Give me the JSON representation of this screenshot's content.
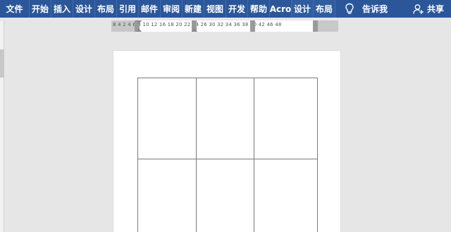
{
  "ribbon": {
    "tabs": [
      {
        "label": "文件"
      },
      {
        "label": "开始"
      },
      {
        "label": "插入"
      },
      {
        "label": "设计"
      },
      {
        "label": "布局"
      },
      {
        "label": "引用"
      },
      {
        "label": "邮件"
      },
      {
        "label": "审阅"
      },
      {
        "label": "新建"
      },
      {
        "label": "视图"
      },
      {
        "label": "开发"
      },
      {
        "label": "帮助"
      },
      {
        "label": "Acro"
      },
      {
        "label": "设计"
      },
      {
        "label": "布局"
      }
    ],
    "tell_me": "告诉我",
    "share": "共享",
    "colors": {
      "ribbon": "#2b579a",
      "text": "#ffffff"
    }
  },
  "ruler": {
    "numbers": "8  4  2      4  6  8  10  12     16  18  20  22  24  26      30  32  34  36  38  40  42      46  48"
  },
  "document": {
    "table": {
      "rows": 2,
      "cols": 3
    }
  }
}
